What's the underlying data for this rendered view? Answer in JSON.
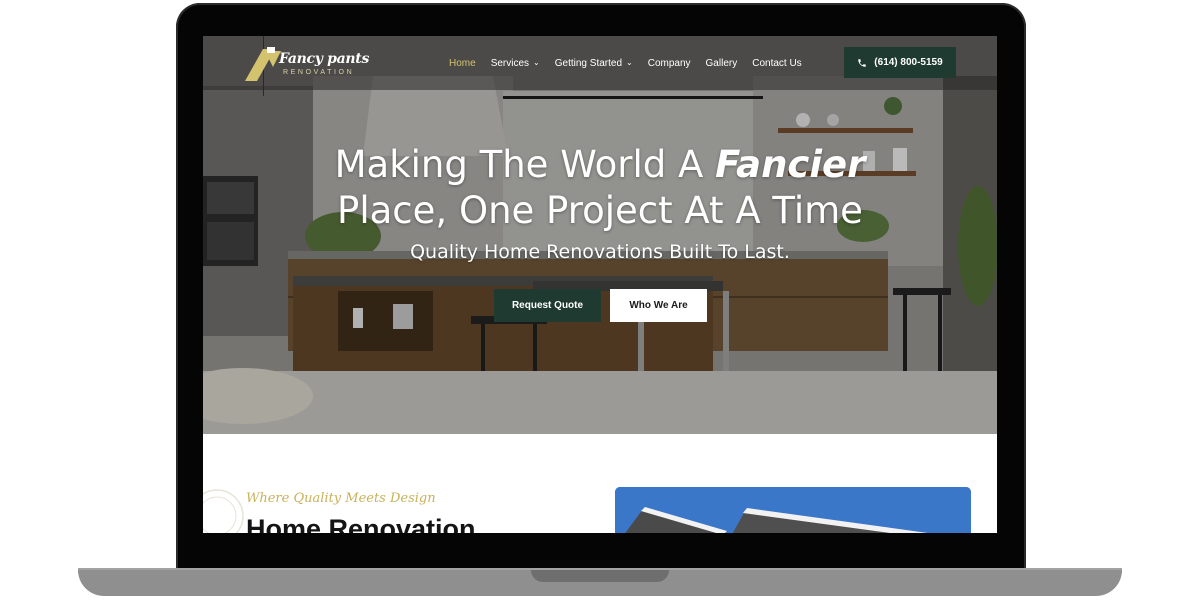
{
  "logo": {
    "name": "Fancy pants",
    "subtitle": "RENOVATION"
  },
  "nav": {
    "items": [
      {
        "label": "Home",
        "active": true,
        "dropdown": false
      },
      {
        "label": "Services",
        "active": false,
        "dropdown": true
      },
      {
        "label": "Getting Started",
        "active": false,
        "dropdown": true
      },
      {
        "label": "Company",
        "active": false,
        "dropdown": false
      },
      {
        "label": "Gallery",
        "active": false,
        "dropdown": false
      },
      {
        "label": "Contact Us",
        "active": false,
        "dropdown": false
      }
    ],
    "phone": "(614) 800-5159",
    "phone_icon": "phone-icon"
  },
  "hero": {
    "title_part1": "Making The World A ",
    "title_emphasis": "Fancier",
    "title_part2": "Place, One Project At A Time",
    "subtitle": "Quality Home Renovations Built To Last.",
    "primary_button": "Request Quote",
    "secondary_button": "Who We Are"
  },
  "section": {
    "tagline": "Where Quality Meets Design",
    "heading": "Home Renovation"
  },
  "colors": {
    "brand_green": "#1f3b31",
    "accent_gold": "#d4c36e",
    "tagline_gold": "#c8b25a",
    "sky_blue": "#3b77c9"
  }
}
